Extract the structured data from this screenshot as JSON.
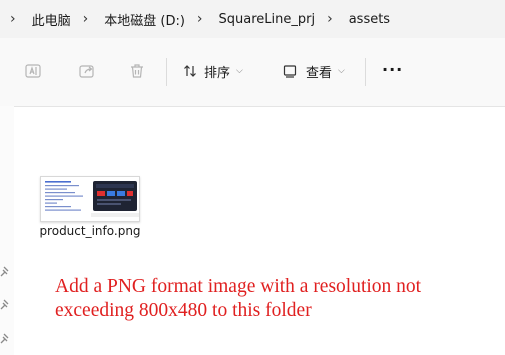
{
  "breadcrumb": {
    "items": [
      "此电脑",
      "本地磁盘 (D:)",
      "SquareLine_prj",
      "assets"
    ],
    "separator": "›"
  },
  "toolbar": {
    "sort_label": "排序",
    "view_label": "查看",
    "more_label": "···",
    "icons": [
      "rename-icon",
      "share-icon",
      "delete-icon",
      "sort-icon",
      "view-icon",
      "more-icon"
    ]
  },
  "file": {
    "name": "product_info.png"
  },
  "annotation": {
    "text": "Add a PNG format image with a resolution not exceeding 800x480 to this folder",
    "color": "#e02020"
  },
  "colors": {
    "breadcrumb_bg": "#f3f3f3",
    "toolbar_bg": "#f9f9f9",
    "accent": "#0067c0"
  }
}
